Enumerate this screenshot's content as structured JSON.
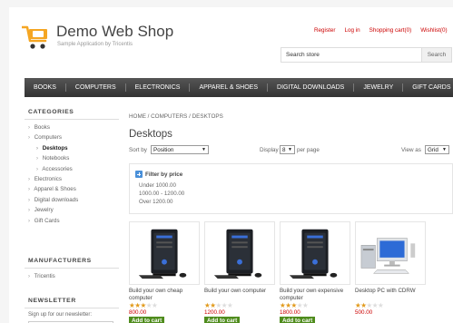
{
  "header": {
    "logo_title": "Demo Web Shop",
    "logo_subtitle": "Sample Application by Tricentis",
    "links": [
      "Register",
      "Log in",
      "Shopping cart(0)",
      "Wishlist(0)"
    ],
    "search_placeholder": "Search store",
    "search_button": "Search"
  },
  "menu": [
    "BOOKS",
    "COMPUTERS",
    "ELECTRONICS",
    "APPAREL & SHOES",
    "DIGITAL DOWNLOADS",
    "JEWELRY",
    "GIFT CARDS"
  ],
  "sidebar": {
    "categories_title": "CATEGORIES",
    "categories": [
      {
        "label": "Books",
        "level": 1
      },
      {
        "label": "Computers",
        "level": 1
      },
      {
        "label": "Desktops",
        "level": 2,
        "active": true
      },
      {
        "label": "Notebooks",
        "level": 2
      },
      {
        "label": "Accessories",
        "level": 2
      },
      {
        "label": "Electronics",
        "level": 1
      },
      {
        "label": "Apparel & Shoes",
        "level": 1
      },
      {
        "label": "Digital downloads",
        "level": 1
      },
      {
        "label": "Jewelry",
        "level": 1
      },
      {
        "label": "Gift Cards",
        "level": 1
      }
    ],
    "manufacturers_title": "MANUFACTURERS",
    "manufacturers": [
      "Tricentis"
    ],
    "newsletter_title": "NEWSLETTER",
    "newsletter_text": "Sign up for our newsletter:"
  },
  "main": {
    "breadcrumb": "HOME / COMPUTERS / DESKTOPS",
    "title": "Desktops",
    "sort_label": "Sort by",
    "sort_value": "Position",
    "display_label": "Display",
    "display_value": "8",
    "per_page_label": "per page",
    "view_label": "View as",
    "view_value": "Grid",
    "filter_title": "Filter by price",
    "filter_options": [
      "Under 1000.00",
      "1000.00 - 1200.00",
      "Over 1200.00"
    ]
  },
  "products": [
    {
      "name": "Build your own cheap computer",
      "rating": 3,
      "price": "800.00",
      "button": "Add to cart",
      "image": "desktop-tower-icon"
    },
    {
      "name": "Build your own computer",
      "rating": 2,
      "price": "1200.00",
      "button": "Add to cart",
      "image": "desktop-tower-icon"
    },
    {
      "name": "Build your own expensive computer",
      "rating": 3,
      "price": "1800.00",
      "button": "Add to cart",
      "image": "desktop-tower-icon"
    },
    {
      "name": "Desktop PC with CDRW",
      "rating": 2,
      "price": "500.00",
      "button": null,
      "image": "desktop-pc-monitor-icon"
    }
  ],
  "colors": {
    "accent": "#cc0000",
    "menu_bg": "#333333",
    "cart_icon": "#f5a623",
    "button": "#4f8c1d",
    "star": "#e29b1e"
  }
}
